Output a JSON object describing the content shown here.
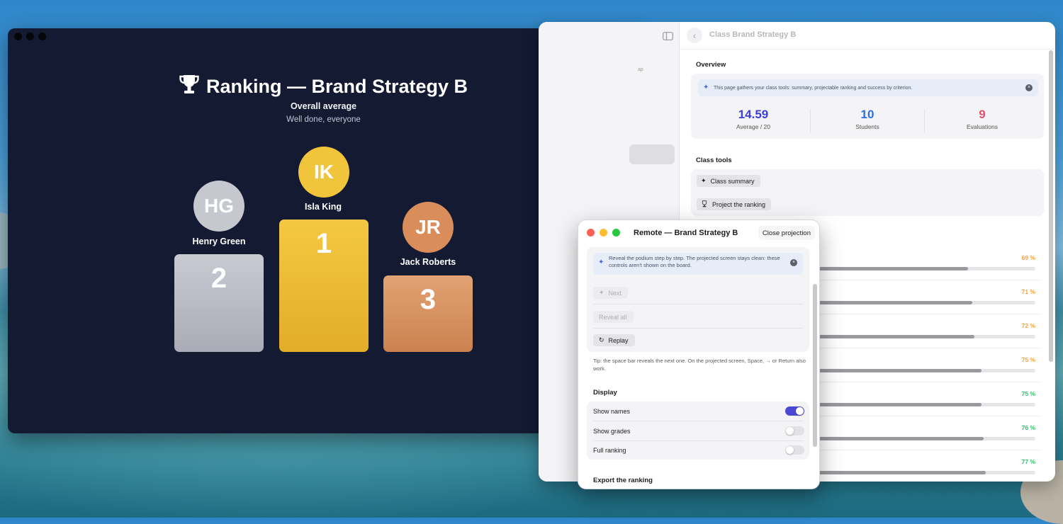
{
  "projection": {
    "title": "Ranking — Brand Strategy B",
    "subtitle": "Overall average",
    "message": "Well done, everyone",
    "podium": [
      {
        "rank": "2",
        "initials": "HG",
        "name": "Henry Green",
        "color": "#c6c8d0"
      },
      {
        "rank": "1",
        "initials": "IK",
        "name": "Isla King",
        "color": "#f0c53c"
      },
      {
        "rank": "3",
        "initials": "JR",
        "name": "Jack Roberts",
        "color": "#d88d5b"
      }
    ]
  },
  "class_window": {
    "title": "Class Brand Strategy B",
    "overview": {
      "heading": "Overview",
      "info": "This page gathers your class tools: summary, projectable ranking and success by criterion.",
      "stats": [
        {
          "value": "14.59",
          "label": "Average / 20",
          "color": "#3b3fd8"
        },
        {
          "value": "10",
          "label": "Students",
          "color": "#2d6fe0"
        },
        {
          "value": "9",
          "label": "Evaluations",
          "color": "#e0506a"
        }
      ]
    },
    "tools": {
      "heading": "Class tools",
      "summary_label": "Class summary",
      "ranking_label": "Project the ranking"
    },
    "criteria": [
      {
        "pct": "69 %",
        "value": 0.69,
        "color": "#f2a33a"
      },
      {
        "pct": "71 %",
        "value": 0.71,
        "color": "#f2a33a"
      },
      {
        "pct": "72 %",
        "value": 0.72,
        "color": "#f2a33a"
      },
      {
        "pct": "75 %",
        "value": 0.75,
        "color": "#f2a33a"
      },
      {
        "pct": "75 %",
        "value": 0.75,
        "color": "#2fbf6a"
      },
      {
        "pct": "76 %",
        "value": 0.76,
        "color": "#2fbf6a"
      },
      {
        "pct": "77 %",
        "value": 0.77,
        "color": "#2fbf6a"
      }
    ]
  },
  "remote": {
    "title": "Remote — Brand Strategy B",
    "close_label": "Close projection",
    "info": "Reveal the podium step by step. The projected screen stays clean: these controls aren't shown on the board.",
    "next_label": "Next",
    "reveal_all_label": "Reveal all",
    "replay_label": "Replay",
    "tip": "Tip: the space bar reveals the next one. On the projected screen, Space, → or Return also work.",
    "display_heading": "Display",
    "toggles": [
      {
        "label": "Show names",
        "on": true
      },
      {
        "label": "Show grades",
        "on": false
      },
      {
        "label": "Full ranking",
        "on": false
      }
    ],
    "export_heading": "Export the ranking"
  }
}
